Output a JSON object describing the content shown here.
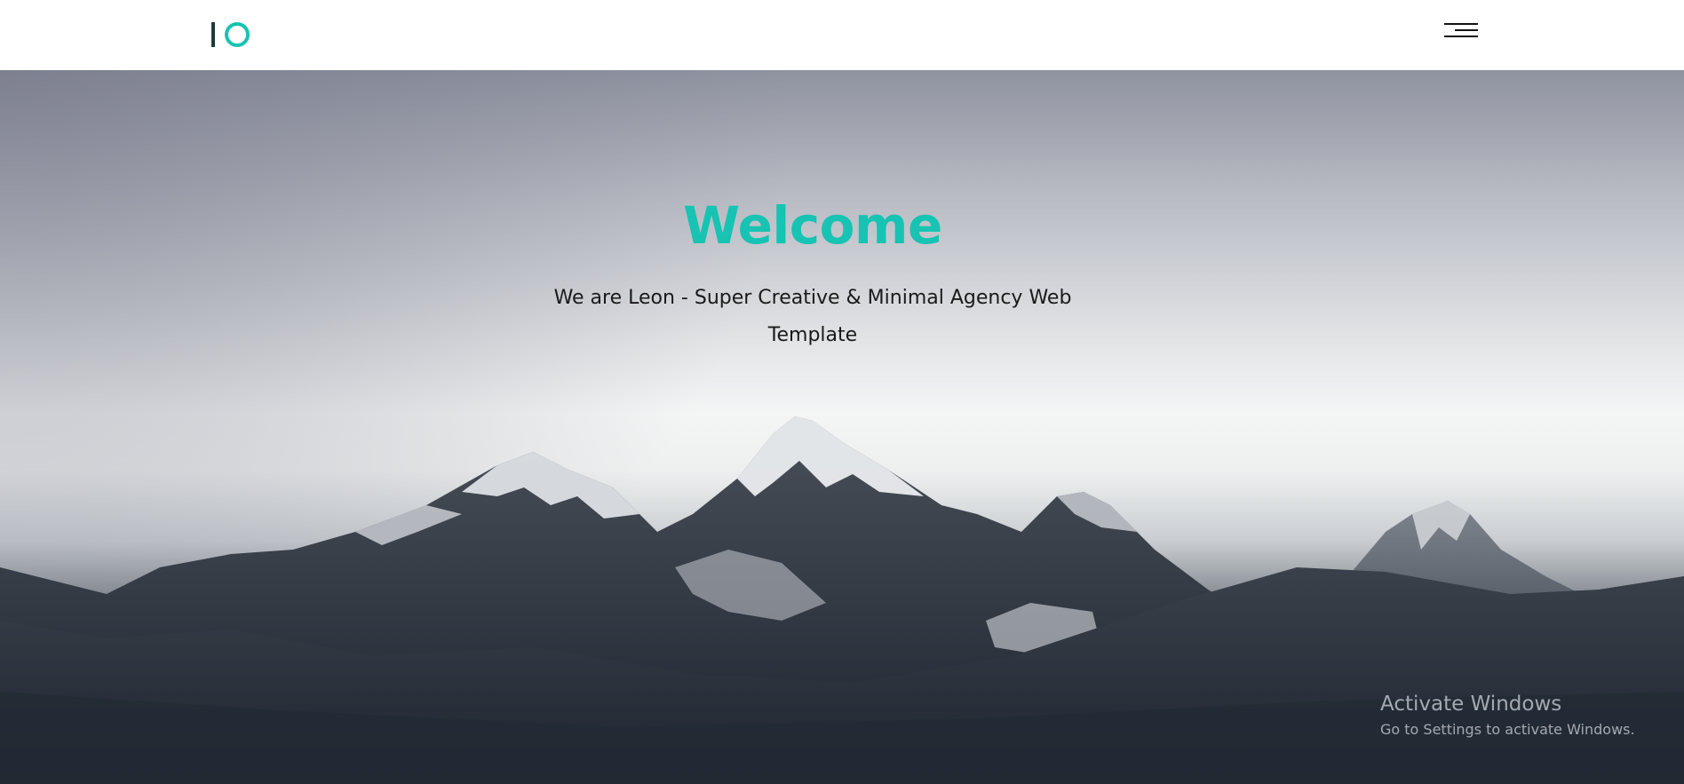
{
  "header": {
    "logo_alt": "IO",
    "menu_icon": "hamburger-menu-icon"
  },
  "hero": {
    "title": "Welcome",
    "subtitle": "We are Leon - Super Creative & Minimal Agency Web Template",
    "background": "snowy-mountain-range-photo"
  },
  "watermark": {
    "title": "Activate Windows",
    "subtitle": "Go to Settings to activate Windows."
  },
  "colors": {
    "accent": "#17c3b2",
    "logo_dark": "#1f3a3d",
    "text": "#1a1a1a"
  }
}
